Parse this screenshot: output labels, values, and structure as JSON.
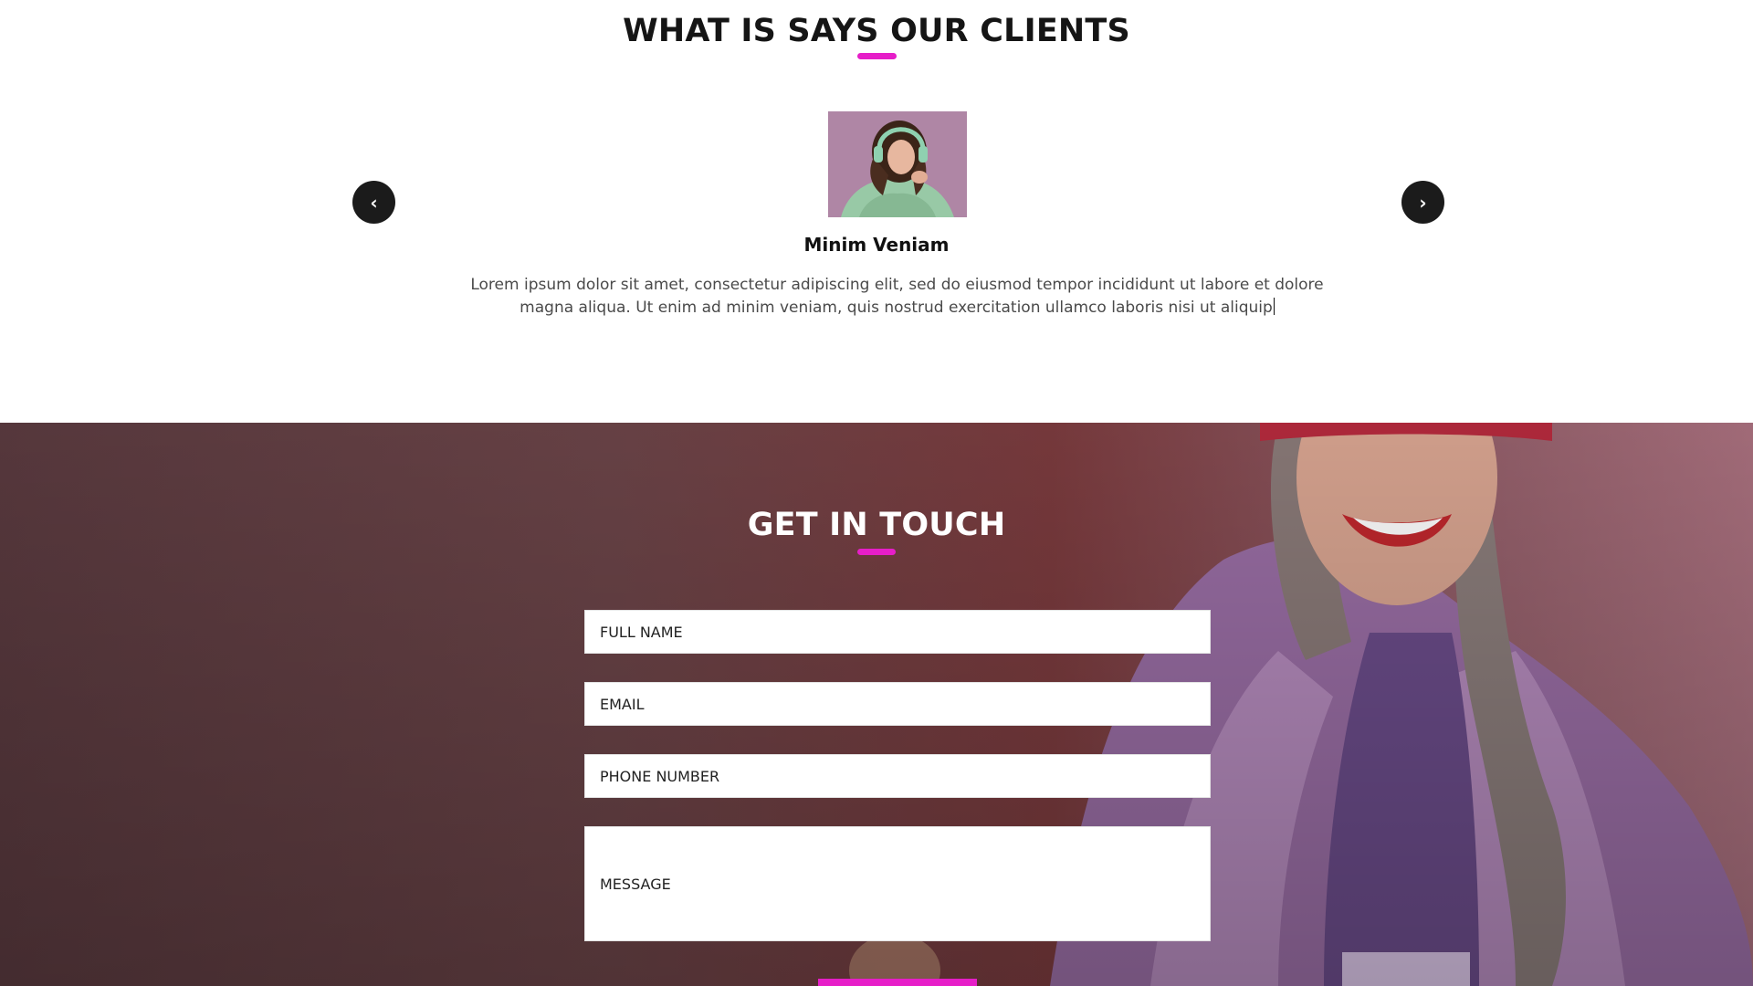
{
  "colors": {
    "accent": "#e61ec8",
    "dark_button": "#1b1b1b",
    "heading_dark": "#151515",
    "heading_light": "#ffffff",
    "body_text": "#4a4a4a"
  },
  "testimonials": {
    "title": "WHAT IS SAYS OUR CLIENTS",
    "prev_icon": "chevron-left-icon",
    "next_icon": "chevron-right-icon",
    "prev_glyph": "‹",
    "next_glyph": "›",
    "client": {
      "name": "Minim Veniam",
      "quote_line1": "Lorem ipsum dolor sit amet, consectetur adipiscing elit, sed do eiusmod tempor incididunt ut labore et dolore",
      "quote_line2": "magna aliqua. Ut enim ad minim veniam, quis nostrud exercitation ullamco laboris nisi ut aliquip"
    }
  },
  "contact": {
    "title": "GET IN TOUCH",
    "fields": {
      "full_name_placeholder": "FULL NAME",
      "email_placeholder": "EMAIL",
      "phone_placeholder": "PHONE NUMBER",
      "message_placeholder": "MESSAGE"
    }
  }
}
